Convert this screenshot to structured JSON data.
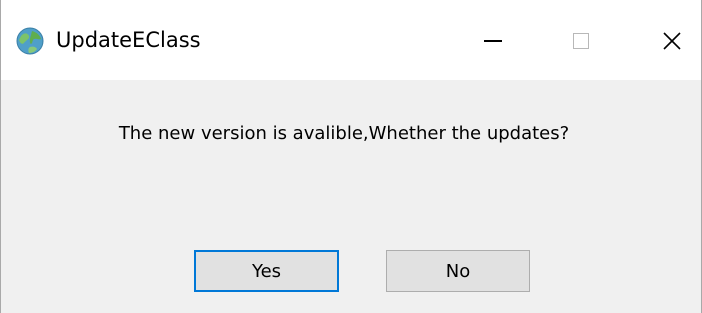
{
  "window": {
    "title": "UpdateEClass",
    "icon": "globe-icon",
    "controls": {
      "minimize": "minimize-icon",
      "maximize": "maximize-icon",
      "close": "close-icon"
    }
  },
  "dialog": {
    "message": "The new version is avalible,Whether the updates?",
    "yes_label": "Yes",
    "no_label": "No"
  },
  "colors": {
    "focus_border": "#0078d7",
    "button_face": "#e1e1e1",
    "dialog_background": "#f0f0f0",
    "titlebar_background": "#ffffff"
  }
}
